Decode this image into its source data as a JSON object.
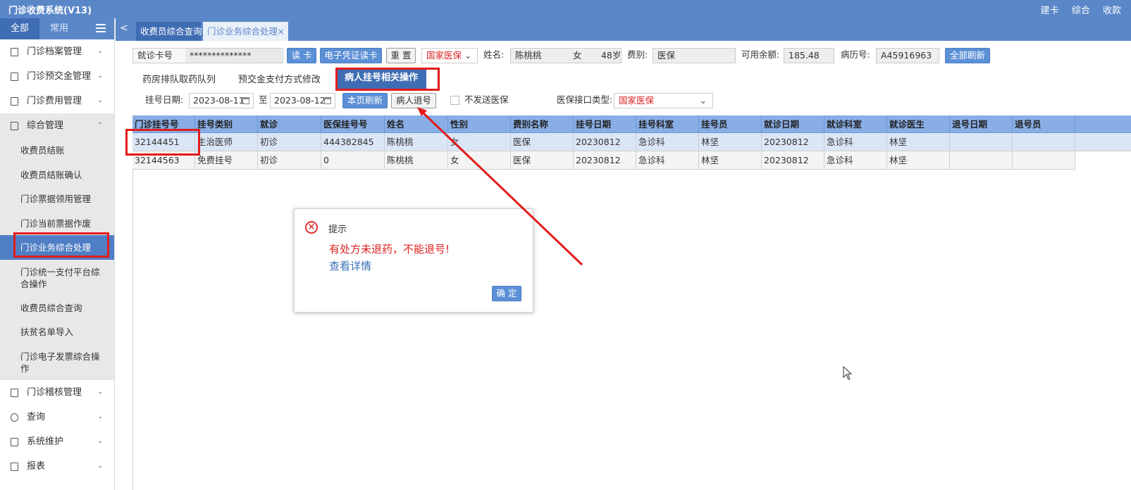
{
  "app": {
    "title": "门诊收费系统(V13)",
    "top_links": [
      "建卡",
      "综合",
      "收款"
    ]
  },
  "sidebar": {
    "tabs": [
      "全部",
      "常用"
    ],
    "groups_top": [
      {
        "label": "门诊档案管理",
        "icon": "file-icon"
      },
      {
        "label": "门诊预交金管理",
        "icon": "wallet-icon"
      },
      {
        "label": "门诊费用管理",
        "icon": "calculator-icon"
      }
    ],
    "open_group": {
      "label": "综合管理",
      "icon": "document-icon"
    },
    "sub_items": [
      "收费员结账",
      "收费员结账确认",
      "门诊票据领用管理",
      "门诊当前票据作废",
      "门诊业务综合处理",
      "门诊统一支付平台综合操作",
      "收费员综合查询",
      "扶贫名单导入",
      "门诊电子发票综合操作"
    ],
    "groups_bottom": [
      {
        "label": "门诊稽核管理",
        "icon": "audit-icon"
      },
      {
        "label": "查询",
        "icon": "search-icon"
      },
      {
        "label": "系统维护",
        "icon": "monitor-icon"
      },
      {
        "label": "报表",
        "icon": "report-icon"
      }
    ]
  },
  "tabs": {
    "back": "<",
    "items": [
      "收费员综合查询",
      "门诊业务综合处理"
    ],
    "close": "×"
  },
  "info": {
    "card_label": "就诊卡号",
    "card_value": "**************",
    "read_card": "读 卡",
    "e_card": "电子凭证读卡",
    "reset": "重 置",
    "insurance_select": "国家医保",
    "name_label": "姓名:",
    "name_value": "陈桃桃",
    "gender": "女",
    "age": "48岁",
    "fee_type_label": "费别:",
    "fee_type_value": "医保",
    "balance_label": "可用余额:",
    "balance_value": "185.48",
    "record_label": "病历号:",
    "record_value": "A45916963",
    "refresh_all": "全部刷新"
  },
  "subtabs": [
    "药房排队取药队列",
    "预交金支付方式修改",
    "病人挂号相关操作"
  ],
  "filter": {
    "date_label": "挂号日期:",
    "date_from": "2023-08-11",
    "to": "至",
    "date_to": "2023-08-12",
    "refresh_page": "本页刷新",
    "refund": "病人退号",
    "no_send": "不发送医保",
    "interface_label": "医保接口类型:",
    "interface_value": "国家医保"
  },
  "grid": {
    "headers": [
      "门诊挂号号",
      "挂号类别",
      "就诊",
      "医保挂号号",
      "姓名",
      "性别",
      "费别名称",
      "挂号日期",
      "挂号科室",
      "挂号员",
      "就诊日期",
      "就诊科室",
      "就诊医生",
      "退号日期",
      "退号员"
    ],
    "rows": [
      [
        "32144451",
        "主治医师",
        "初诊",
        "444382845",
        "陈桃桃",
        "女",
        "医保",
        "20230812",
        "急诊科",
        "林坚",
        "20230812",
        "急诊科",
        "林坚",
        "",
        ""
      ],
      [
        "32144563",
        "免费挂号",
        "初诊",
        "0",
        "陈桃桃",
        "女",
        "医保",
        "20230812",
        "急诊科",
        "林坚",
        "20230812",
        "急诊科",
        "林坚",
        "",
        ""
      ]
    ]
  },
  "dialog": {
    "title": "提示",
    "icon": "error-circle-icon",
    "message": "有处方未退药，不能退号!",
    "link": "查看详情",
    "ok": "确 定"
  },
  "colors": {
    "primary": "#5a87c8",
    "dark_primary": "#3f6db3",
    "header_row": "#89aee6",
    "annotation_red": "#e21b1b"
  }
}
